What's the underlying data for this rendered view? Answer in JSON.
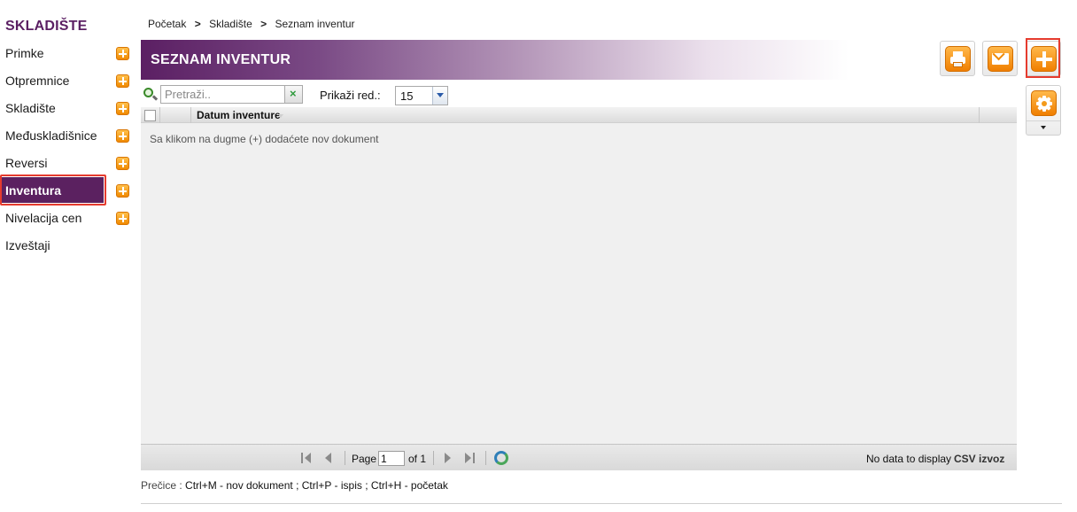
{
  "sidebar": {
    "title": "SKLADIŠTE",
    "items": [
      {
        "label": "Primke",
        "has_add": true
      },
      {
        "label": "Otpremnice",
        "has_add": true
      },
      {
        "label": "Skladište",
        "has_add": true
      },
      {
        "label": "Međuskladišnice",
        "has_add": true
      },
      {
        "label": "Reversi",
        "has_add": true
      },
      {
        "label": "Inventura",
        "has_add": true,
        "active": true
      },
      {
        "label": "Nivelacija cen",
        "has_add": true
      },
      {
        "label": "Izveštaji",
        "has_add": false
      }
    ]
  },
  "breadcrumb": {
    "items": [
      "Početak",
      "Skladište",
      "Seznam inventur"
    ],
    "separator": ">"
  },
  "page": {
    "title": "SEZNAM INVENTUR"
  },
  "toolbar": {
    "icons": [
      "print-icon",
      "mail-icon",
      "plus-icon",
      "gear-icon"
    ]
  },
  "search": {
    "placeholder": "Pretraži..",
    "value": ""
  },
  "page_size": {
    "label": "Prikaži red.:",
    "value": "15"
  },
  "grid": {
    "columns": [
      "Datum inventure"
    ],
    "empty_message": "Sa klikom na dugme (+) dodaćete nov dokument",
    "rows": []
  },
  "pager": {
    "page_label": "Page",
    "current_page": "1",
    "of_label": "of 1",
    "status": "No data to display",
    "csv_label": "CSV izvoz"
  },
  "shortcuts": {
    "label": "Prečice :",
    "items": [
      "Ctrl+M - nov dokument ;",
      "Ctrl+P - ispis ;",
      "Ctrl+H - početak"
    ]
  },
  "colors": {
    "brand": "#5b1f63",
    "accent": "#f08a00",
    "highlight": "#e53b2e"
  }
}
